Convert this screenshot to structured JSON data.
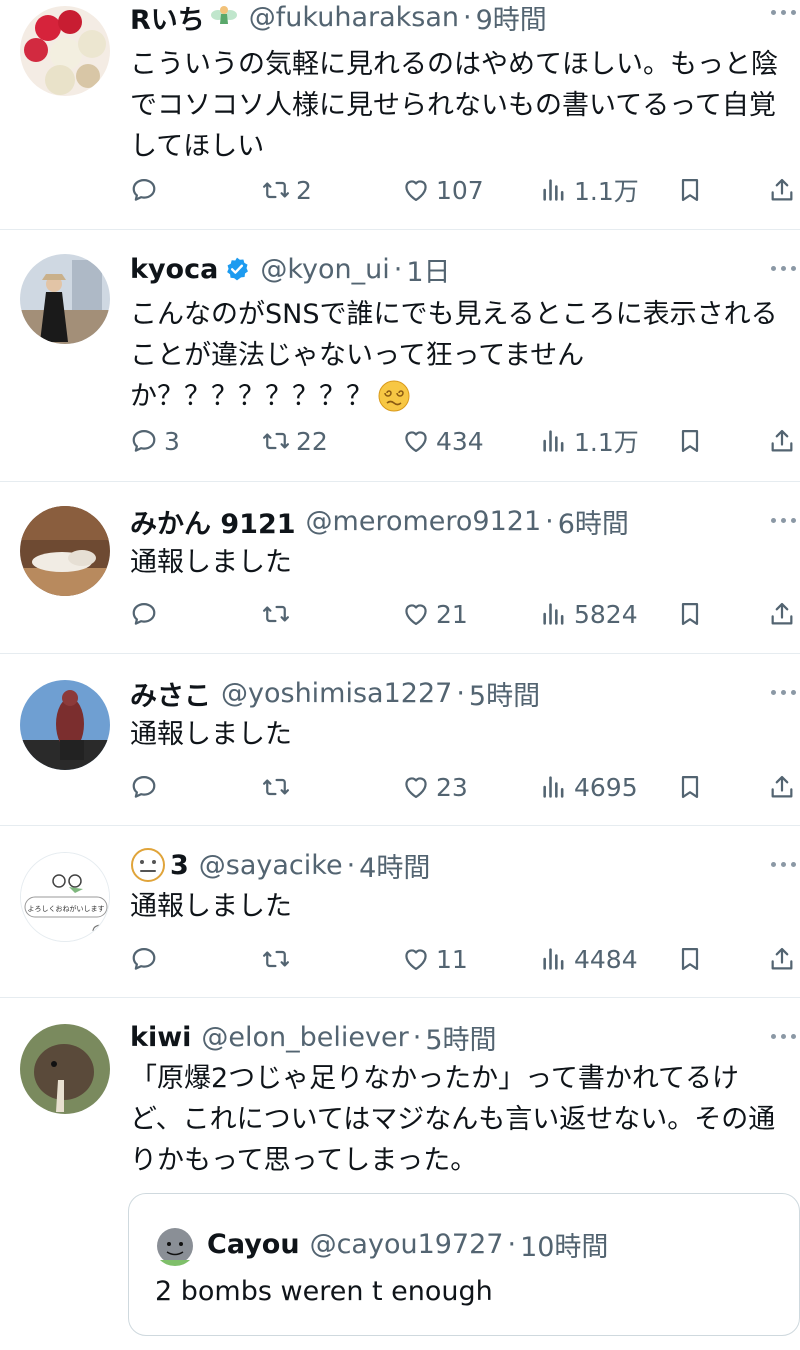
{
  "tweets": [
    {
      "name": "Rいち",
      "handle": "@fukuharaksan",
      "time": "9時間",
      "text": "こういうの気軽に見れるのはやめてほしい。もっと陰でコソコソ人様に見せられないもの書いてるって自覚してほしい",
      "replies": "",
      "retweets": "2",
      "likes": "107",
      "views": "1.1万"
    },
    {
      "name": "kyoca",
      "handle": "@kyon_ui",
      "time": "1日",
      "text": "こんなのがSNSで誰にでも見えるところに表示されることが違法じゃないって狂ってません",
      "text2": "か？？？？？？？？",
      "replies": "3",
      "retweets": "22",
      "likes": "434",
      "views": "1.1万"
    },
    {
      "name": "みかん 9121",
      "handle": "@meromero9121",
      "time": "6時間",
      "text": "通報しました",
      "replies": "",
      "retweets": "",
      "likes": "21",
      "views": "5824"
    },
    {
      "name": "みさこ",
      "handle": "@yoshimisa1227",
      "time": "5時間",
      "text": "通報しました",
      "replies": "",
      "retweets": "",
      "likes": "23",
      "views": "4695"
    },
    {
      "name": "3",
      "handle": "@sayacike",
      "time": "4時間",
      "text": "通報しました",
      "avatar_text": "よろしくおねがいします",
      "replies": "",
      "retweets": "",
      "likes": "11",
      "views": "4484"
    },
    {
      "name": "kiwi",
      "handle": "@elon_believer",
      "time": "5時間",
      "text": "「原爆2つじゃ足りなかったか」って書かれてるけど、これについてはマジなんも言い返せない。その通りかもって思ってしまった。",
      "quote": {
        "name": "Cayou",
        "handle": "@cayou19727",
        "time": "10時間",
        "text": "2 bombs weren t enough"
      }
    }
  ],
  "separator": "·",
  "colors": {
    "text": "#0f1419",
    "secondary": "#536471",
    "verified": "#1d9bf0",
    "border": "#e6ecf0"
  },
  "icons": [
    "reply-icon",
    "retweet-icon",
    "like-icon",
    "views-icon",
    "bookmark-icon",
    "share-icon",
    "more-icon",
    "verified-badge-icon"
  ]
}
